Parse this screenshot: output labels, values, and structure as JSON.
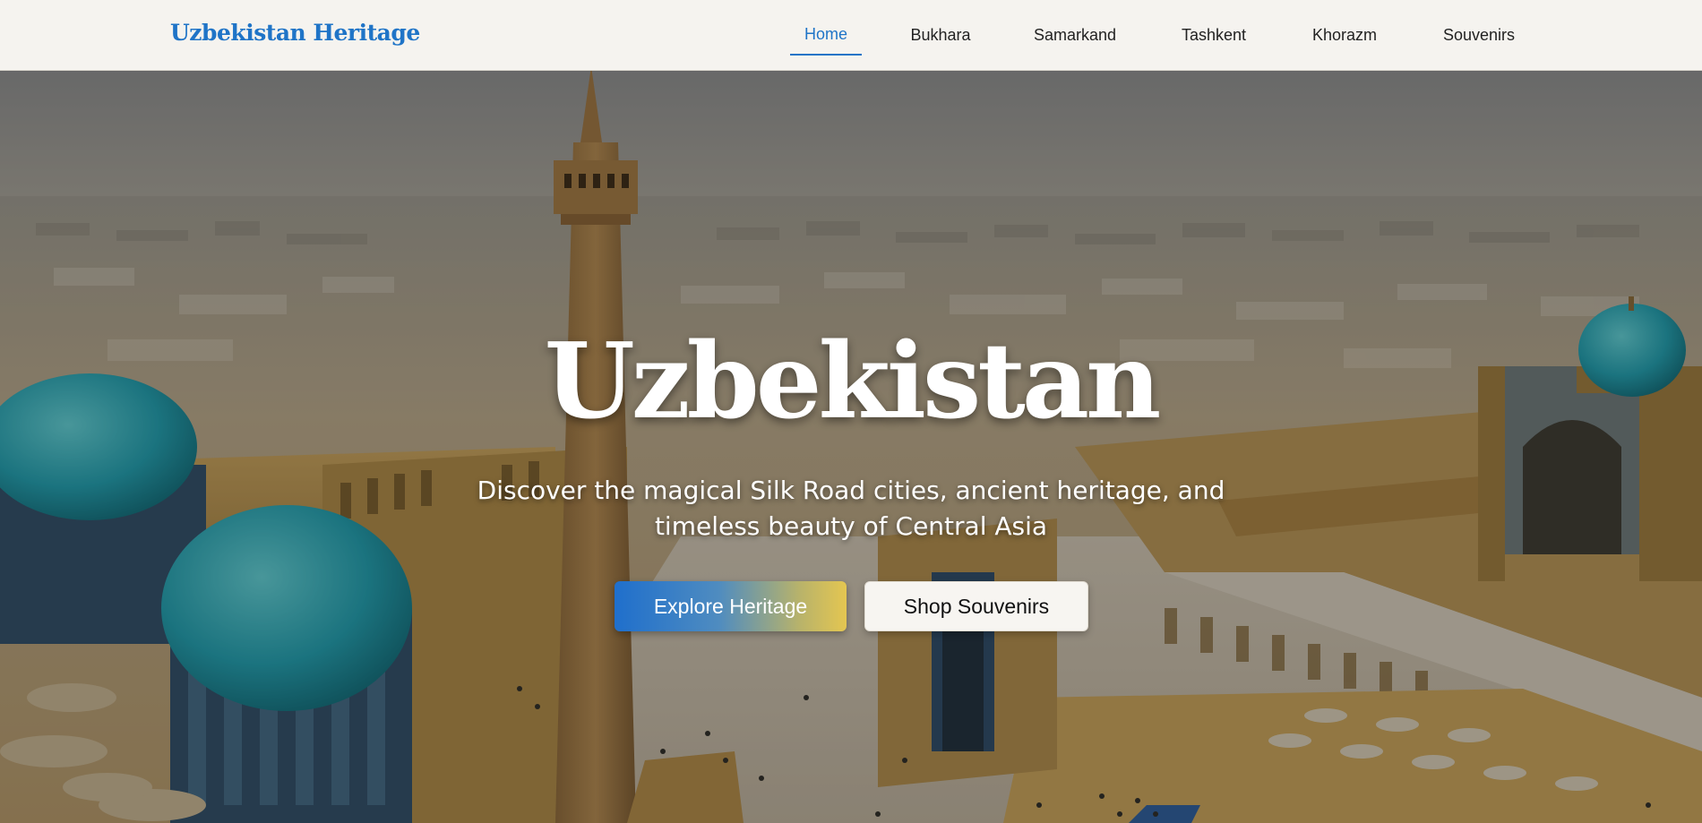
{
  "header": {
    "logo": "Uzbekistan Heritage",
    "nav": [
      {
        "label": "Home",
        "active": true
      },
      {
        "label": "Bukhara",
        "active": false
      },
      {
        "label": "Samarkand",
        "active": false
      },
      {
        "label": "Tashkent",
        "active": false
      },
      {
        "label": "Khorazm",
        "active": false
      },
      {
        "label": "Souvenirs",
        "active": false
      }
    ]
  },
  "hero": {
    "title": "Uzbekistan",
    "subtitle": "Discover the magical Silk Road cities, ancient heritage, and timeless beauty of Central Asia",
    "primary_button": "Explore Heritage",
    "secondary_button": "Shop Souvenirs",
    "background_image": "aerial-bukhara-old-city"
  },
  "colors": {
    "brand_blue": "#1f74c7",
    "header_bg": "#f5f3ef",
    "gradient_end_gold": "#e4c651",
    "dome_turquoise": "#2bb3c2"
  }
}
